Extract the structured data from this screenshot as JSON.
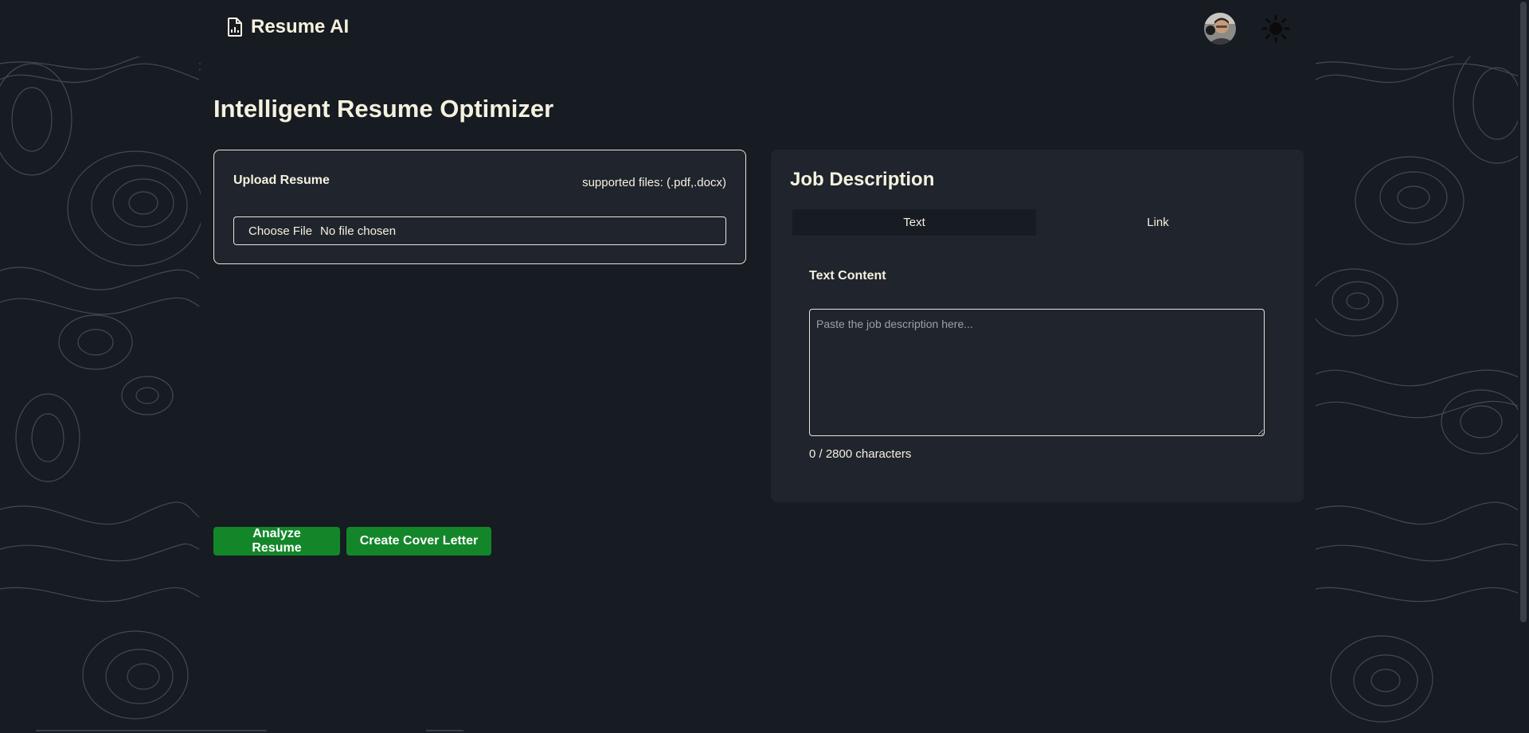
{
  "header": {
    "app_name": "Resume AI",
    "logo_icon": "file-chart-icon",
    "avatar_icon": "user-avatar",
    "theme_icon": "sun-icon"
  },
  "page": {
    "title": "Intelligent Resume Optimizer"
  },
  "upload": {
    "title": "Upload Resume",
    "supported": "supported files: (.pdf,.docx)",
    "choose_label": "Choose File",
    "file_status": "No file chosen"
  },
  "job": {
    "title": "Job Description",
    "tabs": [
      {
        "label": "Text",
        "active": true
      },
      {
        "label": "Link",
        "active": false
      }
    ],
    "text_label": "Text Content",
    "placeholder": "Paste the job description here...",
    "char_count": "0 / 2800 characters"
  },
  "actions": {
    "analyze_label": "Analyze Resume",
    "cover_label": "Create Cover Letter"
  },
  "colors": {
    "background": "#171b22",
    "card": "#20242d",
    "text": "#f4f1de",
    "accent_green": "#13862a"
  }
}
